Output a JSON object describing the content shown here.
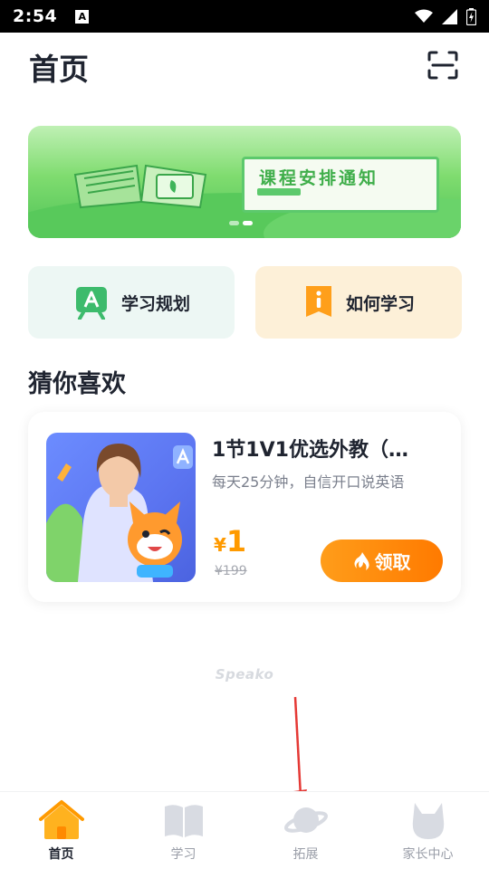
{
  "status_bar": {
    "time": "2:54",
    "notification_glyph": "A"
  },
  "header": {
    "title": "首页",
    "scan_icon": "scan-icon"
  },
  "banner": {
    "title": "课程安排通知",
    "slides": 2,
    "active_slide": 2,
    "colors": {
      "green": "#4fc357",
      "light": "#bff0b4"
    }
  },
  "quick_actions": [
    {
      "label": "学习规划",
      "icon": "study-plan-icon",
      "color": "#3dbb6c"
    },
    {
      "label": "如何学习",
      "icon": "info-icon",
      "color": "#ff9f1a"
    }
  ],
  "recommend": {
    "title": "猜你喜欢",
    "course": {
      "title": "1节1V1优选外教（…",
      "subtitle": "每天25分钟，自信开口说英语",
      "currency": "¥",
      "price": "1",
      "original_price": "¥199",
      "button_label": "领取",
      "accent": "#ff8a00"
    }
  },
  "watermark": "Speako",
  "tabbar": {
    "items": [
      {
        "label": "首页",
        "icon": "home-icon",
        "active": true
      },
      {
        "label": "学习",
        "icon": "book-icon",
        "active": false
      },
      {
        "label": "拓展",
        "icon": "planet-icon",
        "active": false
      },
      {
        "label": "家长中心",
        "icon": "parent-center-icon",
        "active": false
      }
    ]
  }
}
